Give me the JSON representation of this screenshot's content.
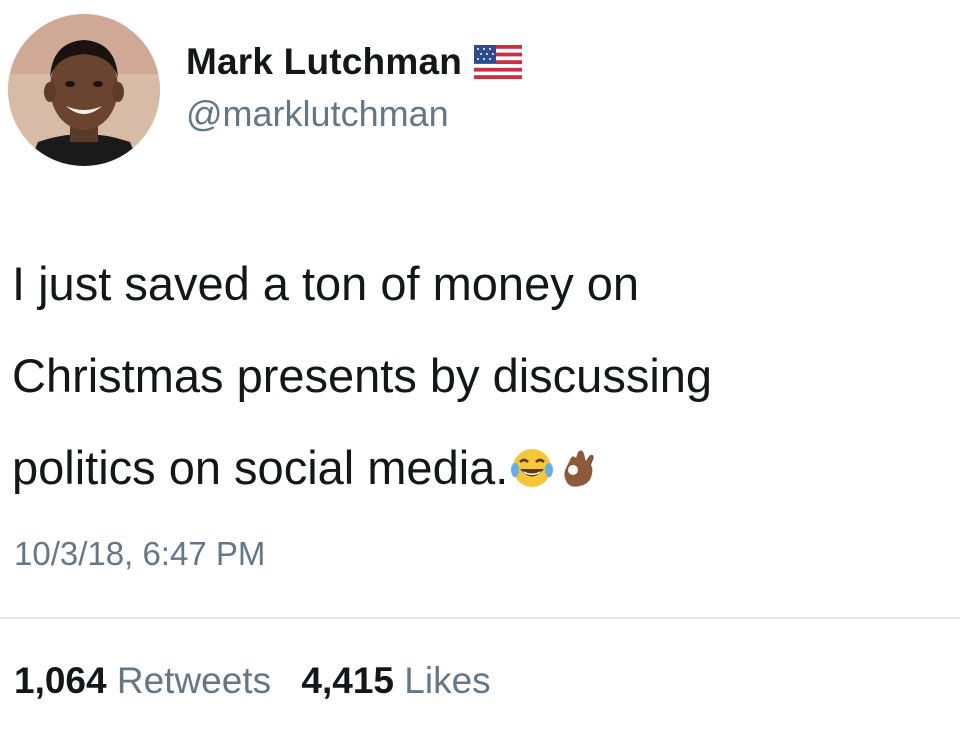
{
  "author": {
    "display_name": "Mark Lutchman",
    "handle": "@marklutchman",
    "avatar_icon": "profile-photo",
    "flag_icon": "us-flag-icon"
  },
  "tweet": {
    "text_lines": [
      "I just saved a ton of money on",
      "Christmas presents by discussing",
      "politics on social media."
    ],
    "emojis": [
      "tears-of-joy-emoji",
      "ok-hand-emoji"
    ],
    "timestamp": "10/3/18, 6:47 PM"
  },
  "stats": {
    "retweets_count": "1,064",
    "retweets_label": "Retweets",
    "likes_count": "4,415",
    "likes_label": "Likes"
  },
  "colors": {
    "text": "#14171a",
    "secondary": "#657786",
    "divider": "#e1e8ed"
  }
}
